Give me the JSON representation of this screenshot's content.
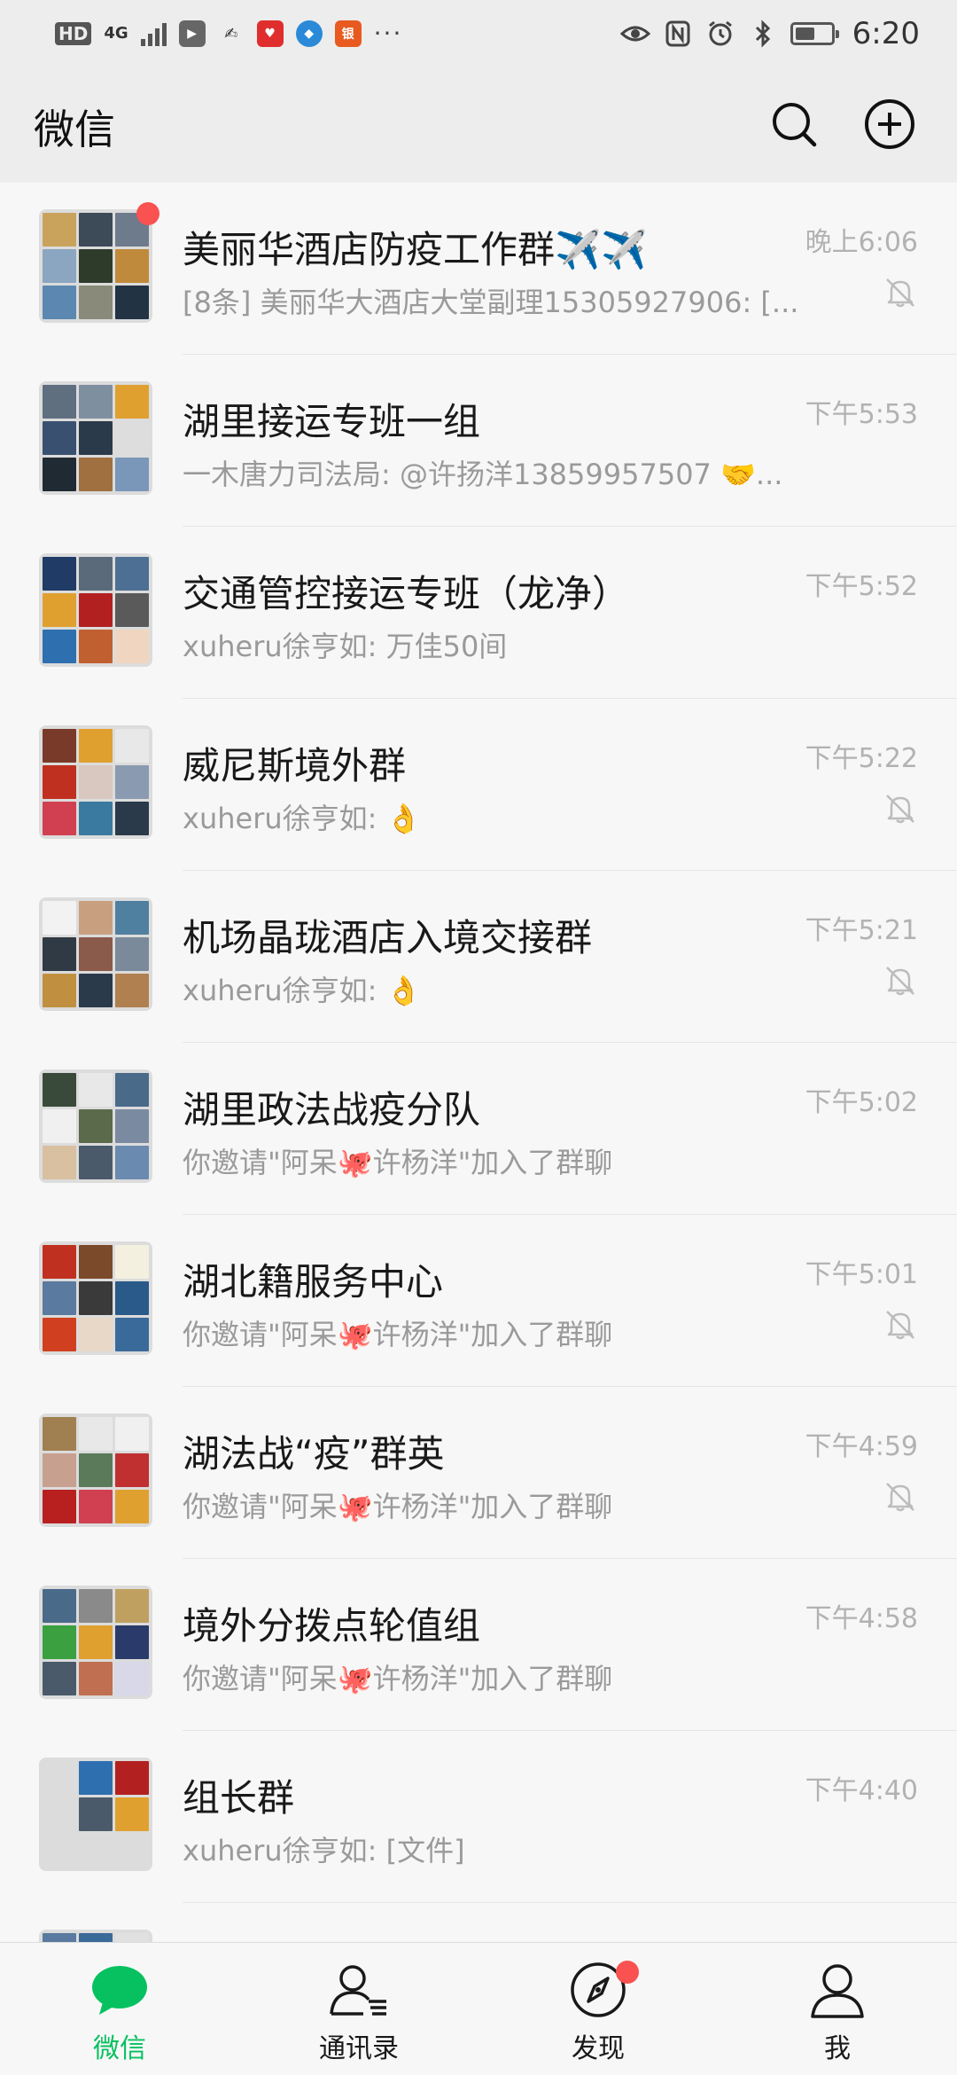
{
  "status_bar": {
    "hd": "HD",
    "network": "4G",
    "time": "6:20",
    "battery_level": 0.55,
    "app_icons": [
      "video-app-icon",
      "news-app-icon",
      "shopping-app-icon",
      "browser-app-icon",
      "bank-app-icon"
    ],
    "status_icons": [
      "eye-icon",
      "nfc-icon",
      "alarm-icon",
      "bluetooth-icon",
      "battery-icon"
    ]
  },
  "header": {
    "title": "微信"
  },
  "chats": [
    {
      "name": "美丽华酒店防疫工作群✈️✈️",
      "time": "晚上6:06",
      "preview": "[8条] 美丽华大酒店大堂副理15305927906: [...",
      "muted": true,
      "unread": true,
      "avatar_colors": [
        "#c9a35b",
        "#3d4a57",
        "#6d7b8c",
        "#8aa6c1",
        "#2f3b2a",
        "#c08a3c",
        "#5b87b0",
        "#8a8a7a",
        "#223344"
      ]
    },
    {
      "name": "湖里接运专班一组",
      "time": "下午5:53",
      "preview": "一木唐力司法局: @许扬洋13859957507 🤝...",
      "muted": false,
      "unread": false,
      "avatar_colors": [
        "#5f6f80",
        "#7e8fa0",
        "#e0a030",
        "#3a5070",
        "#2b3a4a",
        "#dddddd",
        "#1f2a33",
        "#a07040",
        "#7a96b8"
      ]
    },
    {
      "name": "交通管控接运专班（龙净）",
      "time": "下午5:52",
      "preview": "xuheru徐亨如: 万佳50间",
      "muted": false,
      "unread": false,
      "avatar_colors": [
        "#1f3b66",
        "#5a6a7a",
        "#4d6f94",
        "#e0a030",
        "#b32020",
        "#5a5a5a",
        "#2e6fb0",
        "#c06030",
        "#f0d6c0"
      ]
    },
    {
      "name": "威尼斯境外群",
      "time": "下午5:22",
      "preview": "xuheru徐亨如: 👌",
      "muted": true,
      "unread": false,
      "avatar_colors": [
        "#7a3a2a",
        "#e0a030",
        "#e8e8e8",
        "#c03020",
        "#d8c8c0",
        "#8a9ab0",
        "#d04050",
        "#3a7aa0",
        "#2a3a4a"
      ]
    },
    {
      "name": "机场晶珑酒店入境交接群",
      "time": "下午5:21",
      "preview": "xuheru徐亨如: 👌",
      "muted": true,
      "unread": false,
      "avatar_colors": [
        "#f2f2f2",
        "#c8a080",
        "#5080a0",
        "#303a44",
        "#8a5a4a",
        "#7a8a9a",
        "#c09040",
        "#2a3a4a",
        "#b08050"
      ]
    },
    {
      "name": "湖里政法战疫分队",
      "time": "下午5:02",
      "preview": "你邀请\"阿呆🐙许杨洋\"加入了群聊",
      "muted": false,
      "unread": false,
      "avatar_colors": [
        "#3a4a3a",
        "#e8e8e8",
        "#4a6a8a",
        "#f0f0f0",
        "#5a6a4a",
        "#7a8aa0",
        "#d8c0a0",
        "#4a5a6a",
        "#6a8ab0"
      ]
    },
    {
      "name": "湖北籍服务中心",
      "time": "下午5:01",
      "preview": "你邀请\"阿呆🐙许杨洋\"加入了群聊",
      "muted": true,
      "unread": false,
      "avatar_colors": [
        "#c03020",
        "#7a4a2a",
        "#f4f0e0",
        "#5a7aa0",
        "#3a3a3a",
        "#2a5a8a",
        "#d04020",
        "#e8d8c8",
        "#3a6a9a"
      ]
    },
    {
      "name": "湖法战“疫”群英",
      "time": "下午4:59",
      "preview": "你邀请\"阿呆🐙许杨洋\"加入了群聊",
      "muted": true,
      "unread": false,
      "avatar_colors": [
        "#a08050",
        "#e8e8e8",
        "#f0f0f0",
        "#c8a090",
        "#5a7a5a",
        "#c03030",
        "#b82020",
        "#d04050",
        "#e0a030"
      ]
    },
    {
      "name": "境外分拨点轮值组",
      "time": "下午4:58",
      "preview": "你邀请\"阿呆🐙许杨洋\"加入了群聊",
      "muted": false,
      "unread": false,
      "avatar_colors": [
        "#4a6a8a",
        "#8a8a8a",
        "#c0a060",
        "#3aa040",
        "#e0a030",
        "#2a3a6a",
        "#4a5a6a",
        "#c07050",
        "#d8d8e8"
      ]
    },
    {
      "name": "组长群",
      "time": "下午4:40",
      "preview": "xuheru徐亨如: [文件]",
      "muted": false,
      "unread": false,
      "avatar_colors": [
        "#dcdcdc",
        "#2e6fb0",
        "#b32020",
        "#dcdcdc",
        "#4a5a6a",
        "#e0a030",
        "#dcdcdc",
        "#dcdcdc",
        "#dcdcdc"
      ]
    },
    {
      "name": "",
      "time": "",
      "preview": "",
      "muted": false,
      "unread": false,
      "avatar_colors": [
        "#5a7aa0",
        "#3a6a9a",
        "#e0e0e0",
        "#dcdcdc",
        "#dcdcdc",
        "#dcdcdc",
        "#dcdcdc",
        "#dcdcdc",
        "#dcdcdc"
      ]
    }
  ],
  "tabs": [
    {
      "label": "微信",
      "icon": "chat-bubble-icon",
      "active": true,
      "badge": false
    },
    {
      "label": "通讯录",
      "icon": "contacts-icon",
      "active": false,
      "badge": false
    },
    {
      "label": "发现",
      "icon": "compass-icon",
      "active": false,
      "badge": true
    },
    {
      "label": "我",
      "icon": "person-icon",
      "active": false,
      "badge": false
    }
  ],
  "colors": {
    "accent": "#07c160",
    "badge": "#fa5151",
    "header_bg": "#ededed",
    "list_bg": "#f7f7f7"
  }
}
